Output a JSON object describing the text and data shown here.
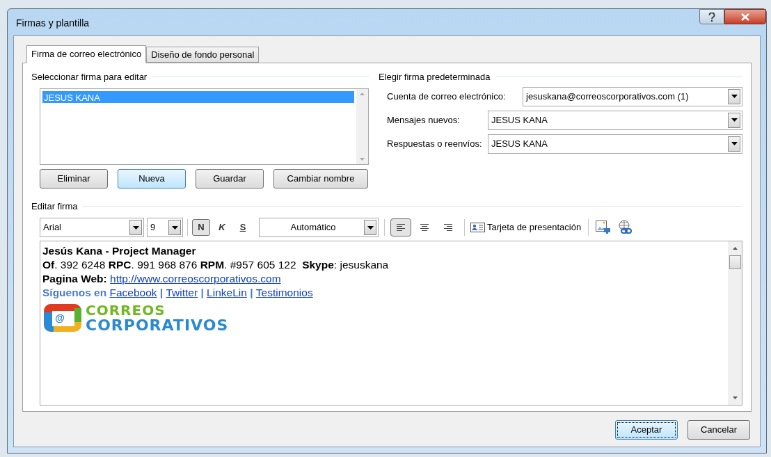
{
  "window": {
    "title": "Firmas y plantilla"
  },
  "tabs": [
    {
      "label": "Firma de correo electrónico",
      "selected": true
    },
    {
      "label": "Diseño de fondo personal",
      "selected": false
    }
  ],
  "select_signature": {
    "title": "Seleccionar firma para editar",
    "items": [
      {
        "label": "JESUS KANA",
        "selected": true
      }
    ],
    "buttons": [
      {
        "label": "Eliminar",
        "focused": false
      },
      {
        "label": "Nueva",
        "focused": true
      },
      {
        "label": "Guardar",
        "focused": false
      },
      {
        "label": "Cambiar nombre",
        "focused": false
      }
    ]
  },
  "default_signature": {
    "title": "Elegir firma predeterminada",
    "fields": [
      {
        "label": "Cuenta de correo electrónico:",
        "value": "jesuskana@correoscorporativos.com (1)"
      },
      {
        "label": "Mensajes nuevos:",
        "value": "JESUS KANA"
      },
      {
        "label": "Respuestas o reenvíos:",
        "value": "JESUS KANA"
      }
    ]
  },
  "edit_signature": {
    "title": "Editar firma",
    "toolbar": {
      "font": "Arial",
      "size": "9",
      "bold": {
        "label": "N",
        "on": true
      },
      "italic": {
        "label": "K",
        "on": false
      },
      "underline": {
        "label": "S",
        "on": false
      },
      "font_color_label": "Automático",
      "align": [
        {
          "kind": "left",
          "selected": true
        },
        {
          "kind": "center",
          "selected": false
        },
        {
          "kind": "right",
          "selected": false
        }
      ],
      "business_card": "Tarjeta de presentación"
    },
    "lines": [
      {
        "segments": [
          {
            "kind": "bold",
            "text": "Jesús Kana - Project Manager"
          }
        ]
      },
      {
        "segments": [
          {
            "kind": "bold",
            "text": "Of"
          },
          {
            "kind": "plain",
            "text": ". 392 6248 "
          },
          {
            "kind": "bold",
            "text": "RPC"
          },
          {
            "kind": "plain",
            "text": ". 991 968 876 "
          },
          {
            "kind": "bold",
            "text": "RPM"
          },
          {
            "kind": "plain",
            "text": ". #957 605 122  "
          },
          {
            "kind": "bold",
            "text": "Skype"
          },
          {
            "kind": "plain",
            "text": ": jesuskana"
          }
        ]
      },
      {
        "segments": [
          {
            "kind": "bold",
            "text": "Pagina Web: "
          },
          {
            "kind": "link",
            "text": "http://www.correoscorporativos.com"
          }
        ]
      },
      {
        "segments": [
          {
            "kind": "accent",
            "text": "Síguenos en "
          },
          {
            "kind": "link",
            "text": "Facebook"
          },
          {
            "kind": "accent",
            "text": " | "
          },
          {
            "kind": "link",
            "text": "Twitter"
          },
          {
            "kind": "accent",
            "text": " | "
          },
          {
            "kind": "link",
            "text": "LinkeLin"
          },
          {
            "kind": "accent",
            "text": " | "
          },
          {
            "kind": "link",
            "text": "Testimonios"
          }
        ]
      }
    ],
    "logo": {
      "symbol": "@",
      "line1": "CORREOS",
      "line2": "CORPORATIVOS"
    }
  },
  "buttons": [
    {
      "label": "Aceptar",
      "focused": true
    },
    {
      "label": "Cancelar",
      "focused": false
    }
  ]
}
